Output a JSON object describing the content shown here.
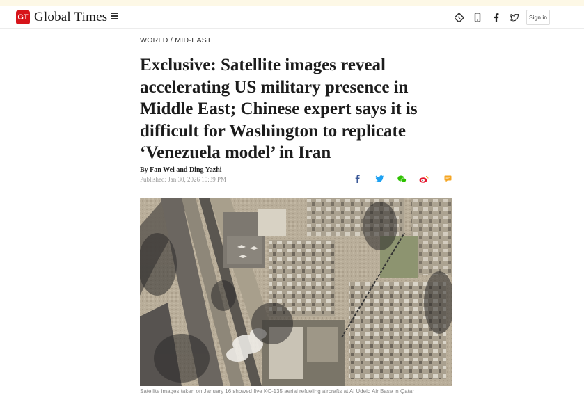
{
  "site": {
    "logo_badge": "GT",
    "logo_text": "Global Times"
  },
  "header": {
    "icons": [
      "newspaper-icon",
      "mobile-icon",
      "facebook-icon",
      "twitter-icon"
    ],
    "signin_label": "Sign in"
  },
  "article": {
    "section": "WORLD",
    "separator": "/",
    "subsection": "MID-EAST",
    "title": "Exclusive: Satellite images reveal accelerating US military presence in Middle East; Chinese expert says it is difficult for Washington to replicate ‘Venezuela model’ in Iran",
    "byline": "By Fan Wei and Ding Yazhi",
    "published": "Published: Jan 30, 2026 10:39 PM",
    "share_icons": [
      "facebook-icon",
      "twitter-icon",
      "wechat-icon",
      "weibo-icon",
      "comment-icon"
    ],
    "image_caption": "Satellite images taken on January 16 showed five KC-135 aerial refueling aircrafts at Al Udeid Air Base in Qatar"
  },
  "colors": {
    "brand_red": "#d7141a",
    "facebook_blue": "#3b5998",
    "twitter_blue": "#1da1f2",
    "wechat_green": "#2dc100",
    "weibo_red": "#e6162d",
    "comment_orange": "#f5a623"
  }
}
